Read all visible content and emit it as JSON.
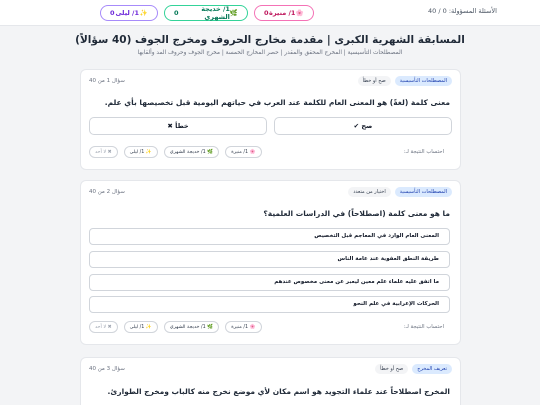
{
  "header": {
    "progress": "الأسئلة المسؤولة: 0 / 40",
    "players": [
      {
        "icon": "🌸",
        "name": "1/ منيرة",
        "score": "0",
        "color": "#f472b6"
      },
      {
        "icon": "🌿",
        "name": "1/ خديجة الشهري",
        "score": "0",
        "color": "#34d399"
      },
      {
        "icon": "✨",
        "name": "1/ ليلى",
        "score": "0",
        "color": "#a78bfa"
      }
    ]
  },
  "page": {
    "title": "المسابقة الشهرية الكبرى | مقدمة مخارج الحروف ومخرج الجوف (40 سؤالاً)",
    "subtitle": "المصطلحات التأسيسية | المخرج المحقق والمقدر | حصر المخارج الخمسة | مخرج الجوف وحروف المد وألقابها"
  },
  "questions": [
    {
      "number": "سؤال 1 من 40",
      "category": "المصطلحات التأسيسية",
      "type": "صح أو خطأ",
      "text": "معنى كلمة (لغةً) هو المعنى العام للكلمة عند العرب في حياتهم اليومية قبل تخصيصها بأي علم.",
      "true_label": "✔ صح",
      "false_label": "✖ خطأ",
      "calc_label": "احتساب النتيجة لـ:",
      "chips": [
        "🌸 1/ منيرة",
        "🌿 1/ خديجة الشهري",
        "✨ 1/ ليلى",
        "✖ لا أحد"
      ]
    },
    {
      "number": "سؤال 2 من 40",
      "category": "المصطلحات التأسيسية",
      "type": "اختيار من متعدد",
      "text": "ما هو معنى كلمة (اصطلاحاً) في الدراسات العلمية؟",
      "options": [
        "المعنى العام الوارد في المعاجم قبل التخصيص",
        "طريقة النطق العفوية عند عامة الناس",
        "ما اتفق عليه علماء علم معين ليعبر عن معنى مخصوص عندهم",
        "الحركات الإعرابية في علم النحو"
      ],
      "calc_label": "احتساب النتيجة لـ:",
      "chips": [
        "🌸 1/ منيرة",
        "🌿 1/ خديجة الشهري",
        "✨ 1/ ليلى",
        "✖ لا أحد"
      ]
    },
    {
      "number": "سؤال 3 من 40",
      "category": "تعريف المخرج",
      "type": "صح أو خطأ",
      "text": "المخرج اصطلاحاً عند علماء التجويد هو اسم مكان لأي موضع نخرج منه كالباب ومخرج الطوارئ."
    }
  ]
}
